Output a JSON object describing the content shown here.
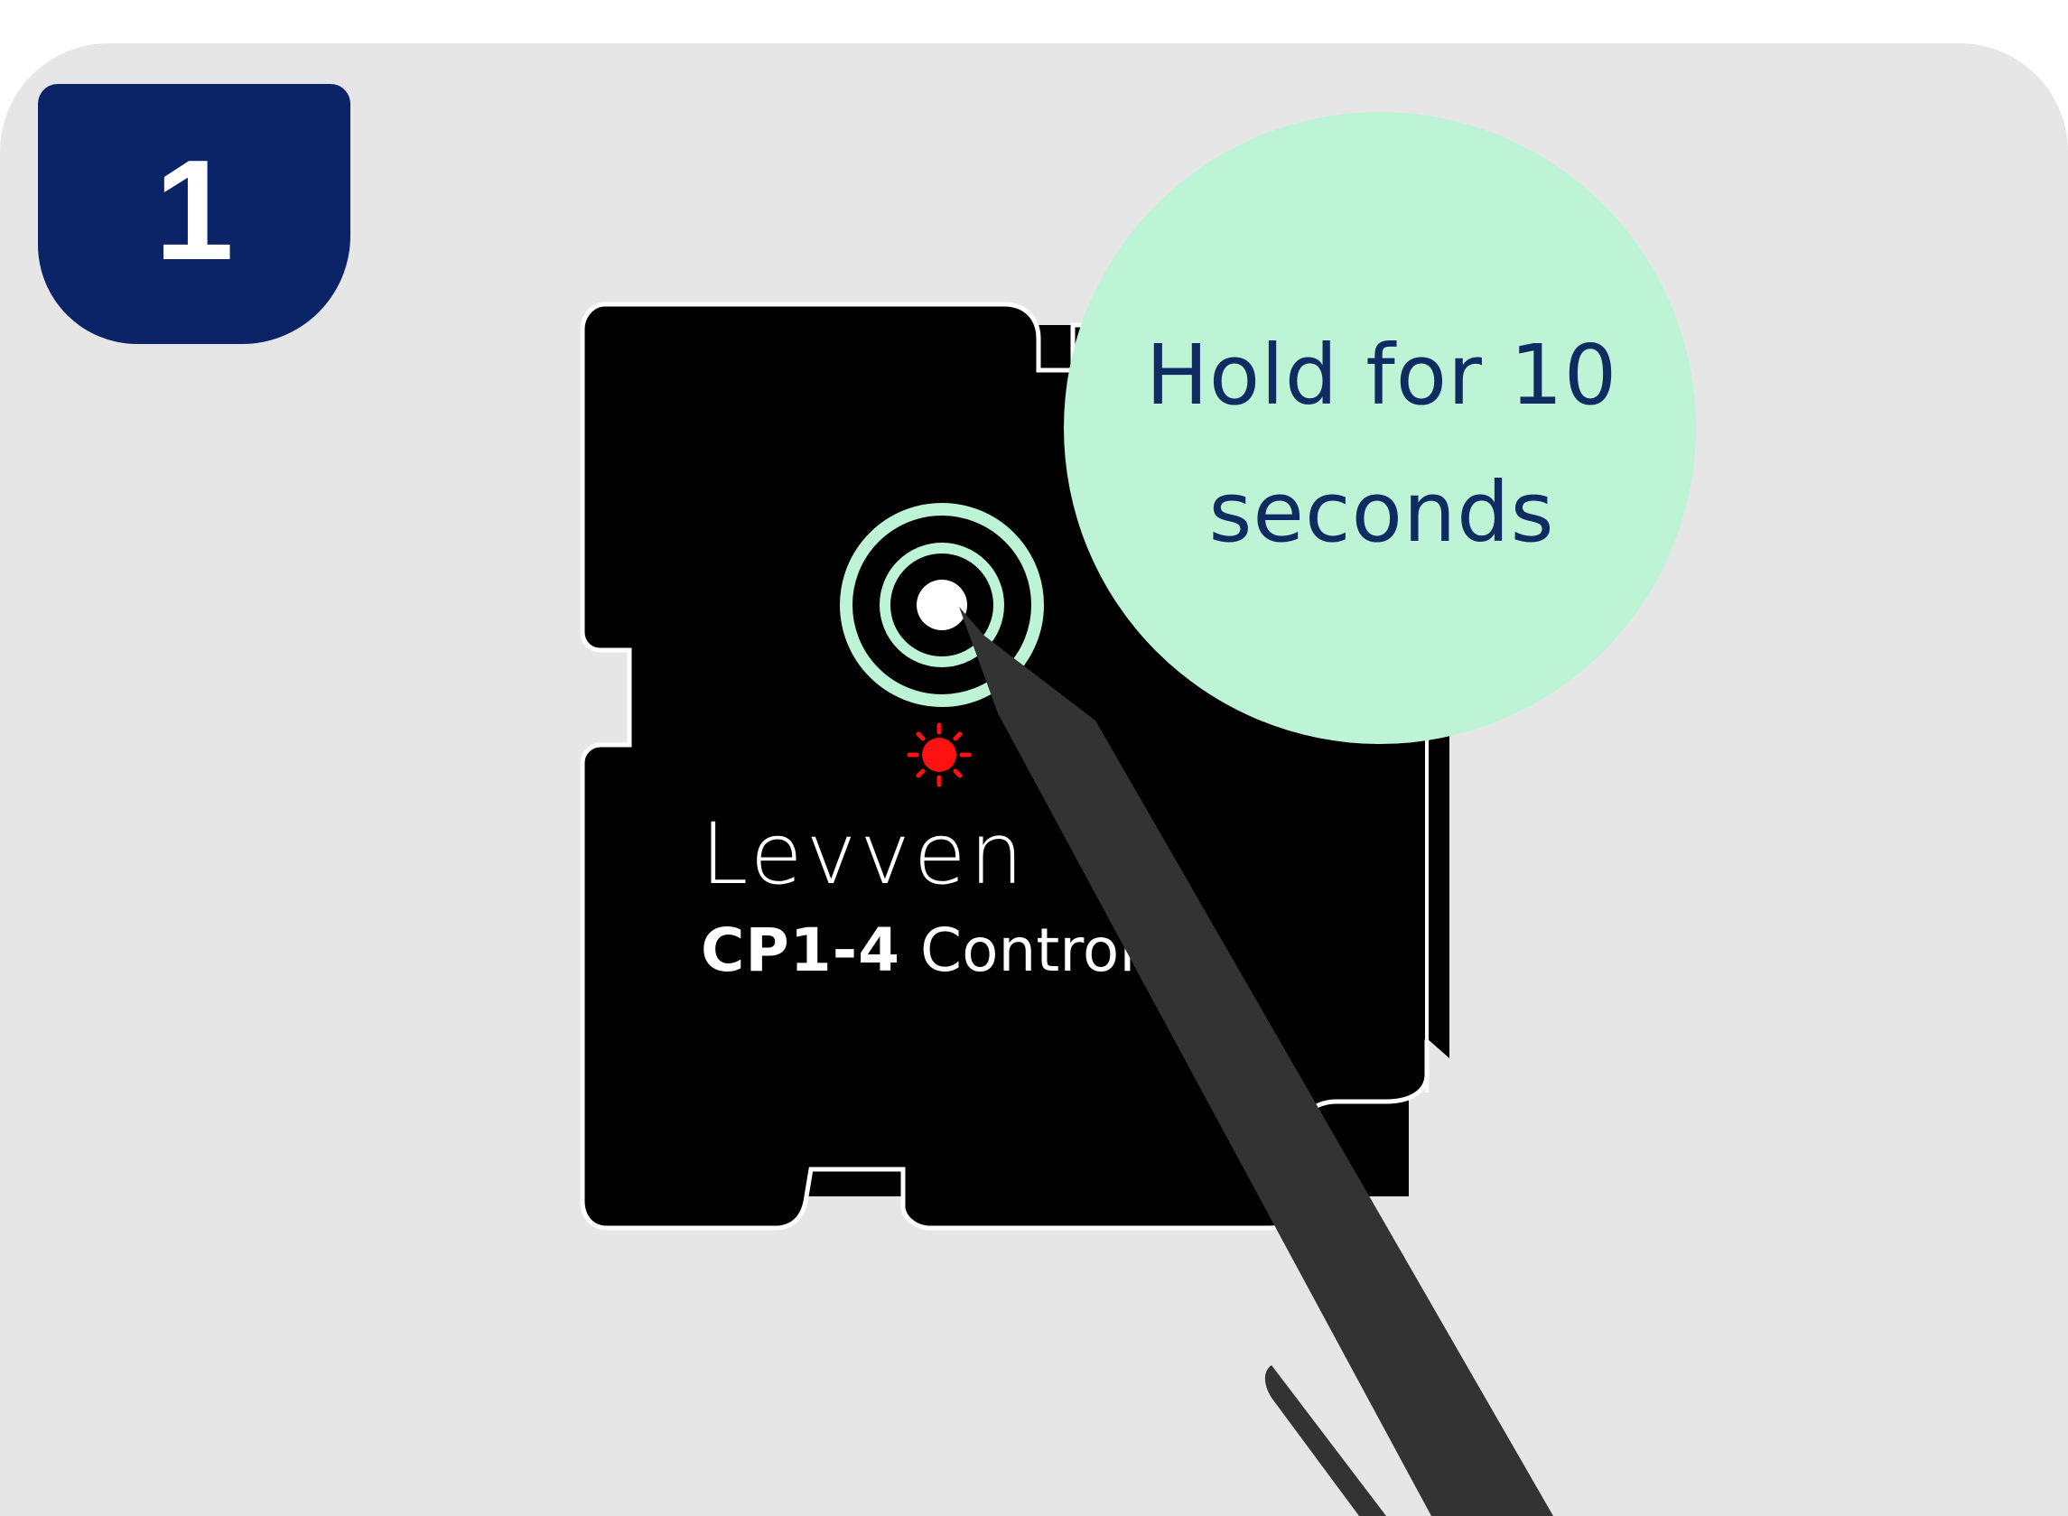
{
  "step": {
    "number": "1"
  },
  "callout": {
    "text": "Hold for 10\nseconds"
  },
  "device": {
    "brand": "Levven",
    "model": "CP1-4",
    "type": "Controller"
  },
  "icons": {
    "reset_button": "reset-button-icon",
    "status_led": "status-led-icon",
    "stylus": "stylus-icon"
  },
  "colors": {
    "panel_background": "#e6e6e6",
    "badge": "#0b2467",
    "callout_bubble": "#bdf4d5",
    "callout_text": "#0e2b62",
    "device_body": "#000000",
    "stylus": "#333333",
    "led": "#ff1111"
  }
}
